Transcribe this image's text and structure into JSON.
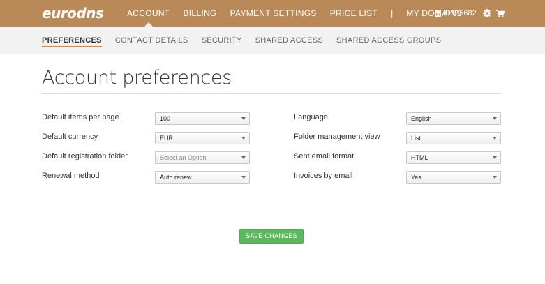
{
  "logo": "eurodns",
  "main_nav": [
    {
      "label": "ACCOUNT",
      "active": true
    },
    {
      "label": "BILLING",
      "active": false
    },
    {
      "label": "PAYMENT SETTINGS",
      "active": false
    },
    {
      "label": "PRICE LIST",
      "active": false
    },
    {
      "label": "|",
      "separator": true
    },
    {
      "label": "MY DOMAINS",
      "active": false
    }
  ],
  "user": {
    "id": "ID195682",
    "icons": [
      "user-icon",
      "gear-icon",
      "cart-icon"
    ]
  },
  "sub_nav": [
    {
      "label": "PREFERENCES",
      "active": true
    },
    {
      "label": "CONTACT DETAILS",
      "active": false
    },
    {
      "label": "SECURITY",
      "active": false
    },
    {
      "label": "SHARED ACCESS",
      "active": false
    },
    {
      "label": "SHARED ACCESS GROUPS",
      "active": false
    }
  ],
  "page_title": "Account preferences",
  "left_fields": [
    {
      "label": "Default items per page",
      "value": "100",
      "placeholder": false
    },
    {
      "label": "Default currency",
      "value": "EUR",
      "placeholder": false
    },
    {
      "label": "Default registration folder",
      "value": "Select an Option",
      "placeholder": true
    },
    {
      "label": "Renewal method",
      "value": "Auto renew",
      "placeholder": false
    }
  ],
  "right_fields": [
    {
      "label": "Language",
      "value": "English",
      "placeholder": false
    },
    {
      "label": "Folder management view",
      "value": "List",
      "placeholder": false
    },
    {
      "label": "Sent email format",
      "value": "HTML",
      "placeholder": false
    },
    {
      "label": "Invoices by email",
      "value": "Yes",
      "placeholder": false
    }
  ],
  "save_label": "SAVE CHANGES",
  "colors": {
    "header": "#b98a58",
    "subbar": "#f2f2f2",
    "accent": "#c9874a",
    "save": "#5cb85c"
  }
}
